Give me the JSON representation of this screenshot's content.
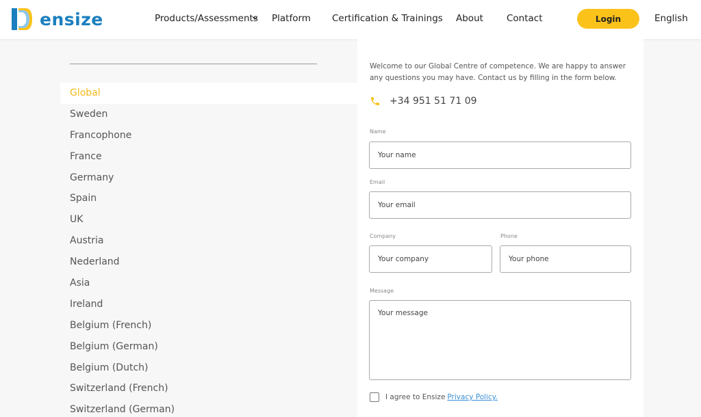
{
  "header": {
    "logo_text": "ensize",
    "brand_color": "#1b7fbf",
    "accent_color": "#fbc21a",
    "nav": [
      {
        "label": "Products/Assessments",
        "has_dropdown": true
      },
      {
        "label": "Platform"
      },
      {
        "label": "Certification & Trainings"
      },
      {
        "label": "About"
      },
      {
        "label": "Contact"
      }
    ],
    "login_label": "Login",
    "language": "English"
  },
  "countries": {
    "active": "Global",
    "items": [
      "Global",
      "Sweden",
      "Francophone",
      "France",
      "Germany",
      "Spain",
      "UK",
      "Austria",
      "Nederland",
      "Asia",
      "Ireland",
      "Belgium (French)",
      "Belgium (German)",
      "Belgium (Dutch)",
      "Switzerland (French)",
      "Switzerland (German)"
    ]
  },
  "contact": {
    "welcome": "Welcome to our Global Centre of competence. We are happy to answer any questions you may have. Contact us by filling in the form below.",
    "phone_icon": "phone-icon",
    "phone": "+34 951 51 71 09",
    "form": {
      "name_label": "Name",
      "name_placeholder": "Your name",
      "email_label": "Email",
      "email_placeholder": "Your email",
      "company_label": "Company",
      "company_placeholder": "Your company",
      "phone_label": "Phone",
      "phone_placeholder": "Your phone",
      "message_label": "Message",
      "message_placeholder": "Your message",
      "agree_text": "I agree to Ensize",
      "privacy_link": "Privacy Policy."
    }
  }
}
